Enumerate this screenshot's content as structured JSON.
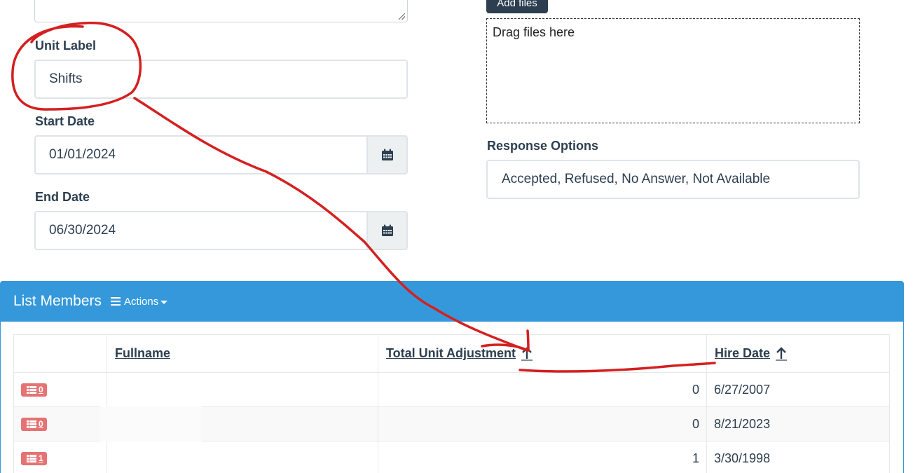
{
  "form": {
    "unit_label": {
      "label": "Unit Label",
      "value": "Shifts"
    },
    "start_date": {
      "label": "Start Date",
      "value": "01/01/2024"
    },
    "end_date": {
      "label": "End Date",
      "value": "06/30/2024"
    },
    "add_files_label": "Add files",
    "dropzone_text": "Drag files here",
    "response_options": {
      "label": "Response Options",
      "value": "Accepted, Refused, No Answer, Not Available"
    }
  },
  "panel": {
    "title": "List Members",
    "actions_label": "Actions"
  },
  "table": {
    "headers": {
      "fullname": "Fullname",
      "total_unit_adjustment": "Total Unit Adjustment",
      "hire_date": "Hire Date"
    },
    "rows": [
      {
        "badge": "0",
        "fullname": "",
        "total_unit_adjustment": "0",
        "hire_date": "6/27/2007"
      },
      {
        "badge": "0",
        "fullname": "",
        "total_unit_adjustment": "0",
        "hire_date": "8/21/2023"
      },
      {
        "badge": "1",
        "fullname": "",
        "total_unit_adjustment": "1",
        "hire_date": "3/30/1998"
      }
    ]
  },
  "icons": {
    "calendar": "calendar-icon",
    "sort": "arrow-up-icon",
    "list": "list-icon",
    "menu": "hamburger-icon"
  },
  "colors": {
    "panel_header": "#3498db",
    "badge": "#e57373",
    "annotation": "#d42020",
    "dark_button": "#2c3e50"
  }
}
